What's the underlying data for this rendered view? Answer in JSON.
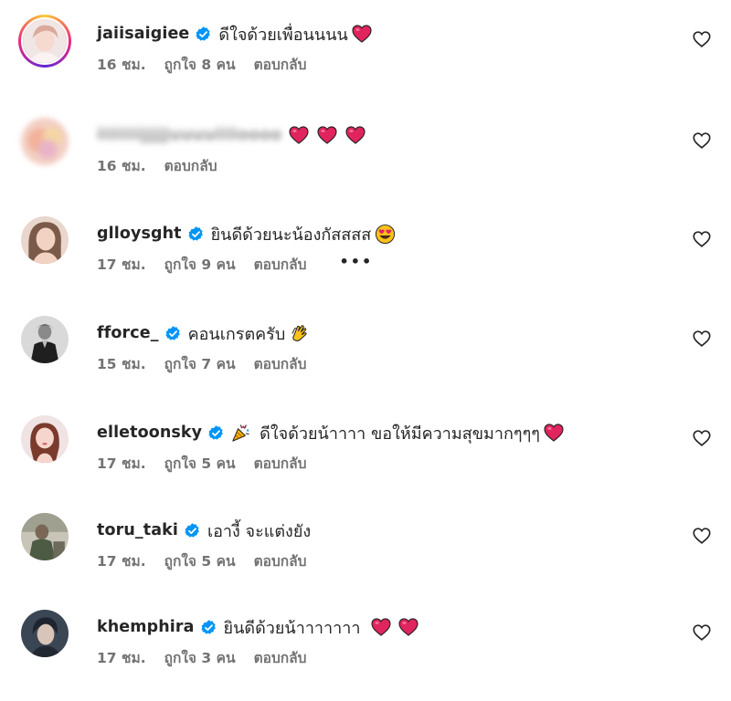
{
  "comments": [
    {
      "username": "jaiisaigiee",
      "verified": true,
      "text": "ดีใจด้วยเพื่อนนนน",
      "time": "16 ชม.",
      "likes": "ถูกใจ 8 คน",
      "reply": "ตอบกลับ",
      "emojis": [
        "red-heart"
      ]
    },
    {
      "username": "iiiiiiiijjjjjuuuuiiiioooo",
      "verified": false,
      "text": "",
      "time": "16 ชม.",
      "likes": "",
      "reply": "ตอบกลับ",
      "emojis": [
        "red-heart",
        "red-heart",
        "red-heart"
      ]
    },
    {
      "username": "glloysght",
      "verified": true,
      "text": "ยินดีด้วยนะน้องกัสสสส",
      "time": "17 ชม.",
      "likes": "ถูกใจ 9 คน",
      "reply": "ตอบกลับ",
      "more": "•••",
      "emojis": [
        "heart-eyes-face"
      ]
    },
    {
      "username": "fforce_",
      "verified": true,
      "text": "คอนเกรตครับ",
      "time": "15 ชม.",
      "likes": "ถูกใจ 7 คน",
      "reply": "ตอบกลับ",
      "emojis": [
        "clapping-hands"
      ]
    },
    {
      "username": "elletoonsky",
      "verified": true,
      "text": "ดีใจด้วยน้าาาา ขอให้มีความสุขมากๆๆๆ",
      "time": "17 ชม.",
      "likes": "ถูกใจ 5 คน",
      "reply": "ตอบกลับ",
      "emojis": [
        "party-popper",
        "red-heart"
      ]
    },
    {
      "username": "toru_taki",
      "verified": true,
      "text": "เอางี้ จะแต่งยัง",
      "time": "17 ชม.",
      "likes": "ถูกใจ 5 คน",
      "reply": "ตอบกลับ",
      "emojis": []
    },
    {
      "username": "khemphira",
      "verified": true,
      "text": "ยินดีด้วยน้าาาาาาา",
      "time": "17 ชม.",
      "likes": "ถูกใจ 3 คน",
      "reply": "ตอบกลับ",
      "emojis": [
        "red-heart",
        "red-heart"
      ]
    }
  ],
  "icons": {
    "like": "heart-outline-icon",
    "verified": "verified-badge-icon"
  },
  "colors": {
    "verified": "#0095f6",
    "heart": "#e0245e",
    "meta_text": "#737373",
    "text": "#262626"
  }
}
